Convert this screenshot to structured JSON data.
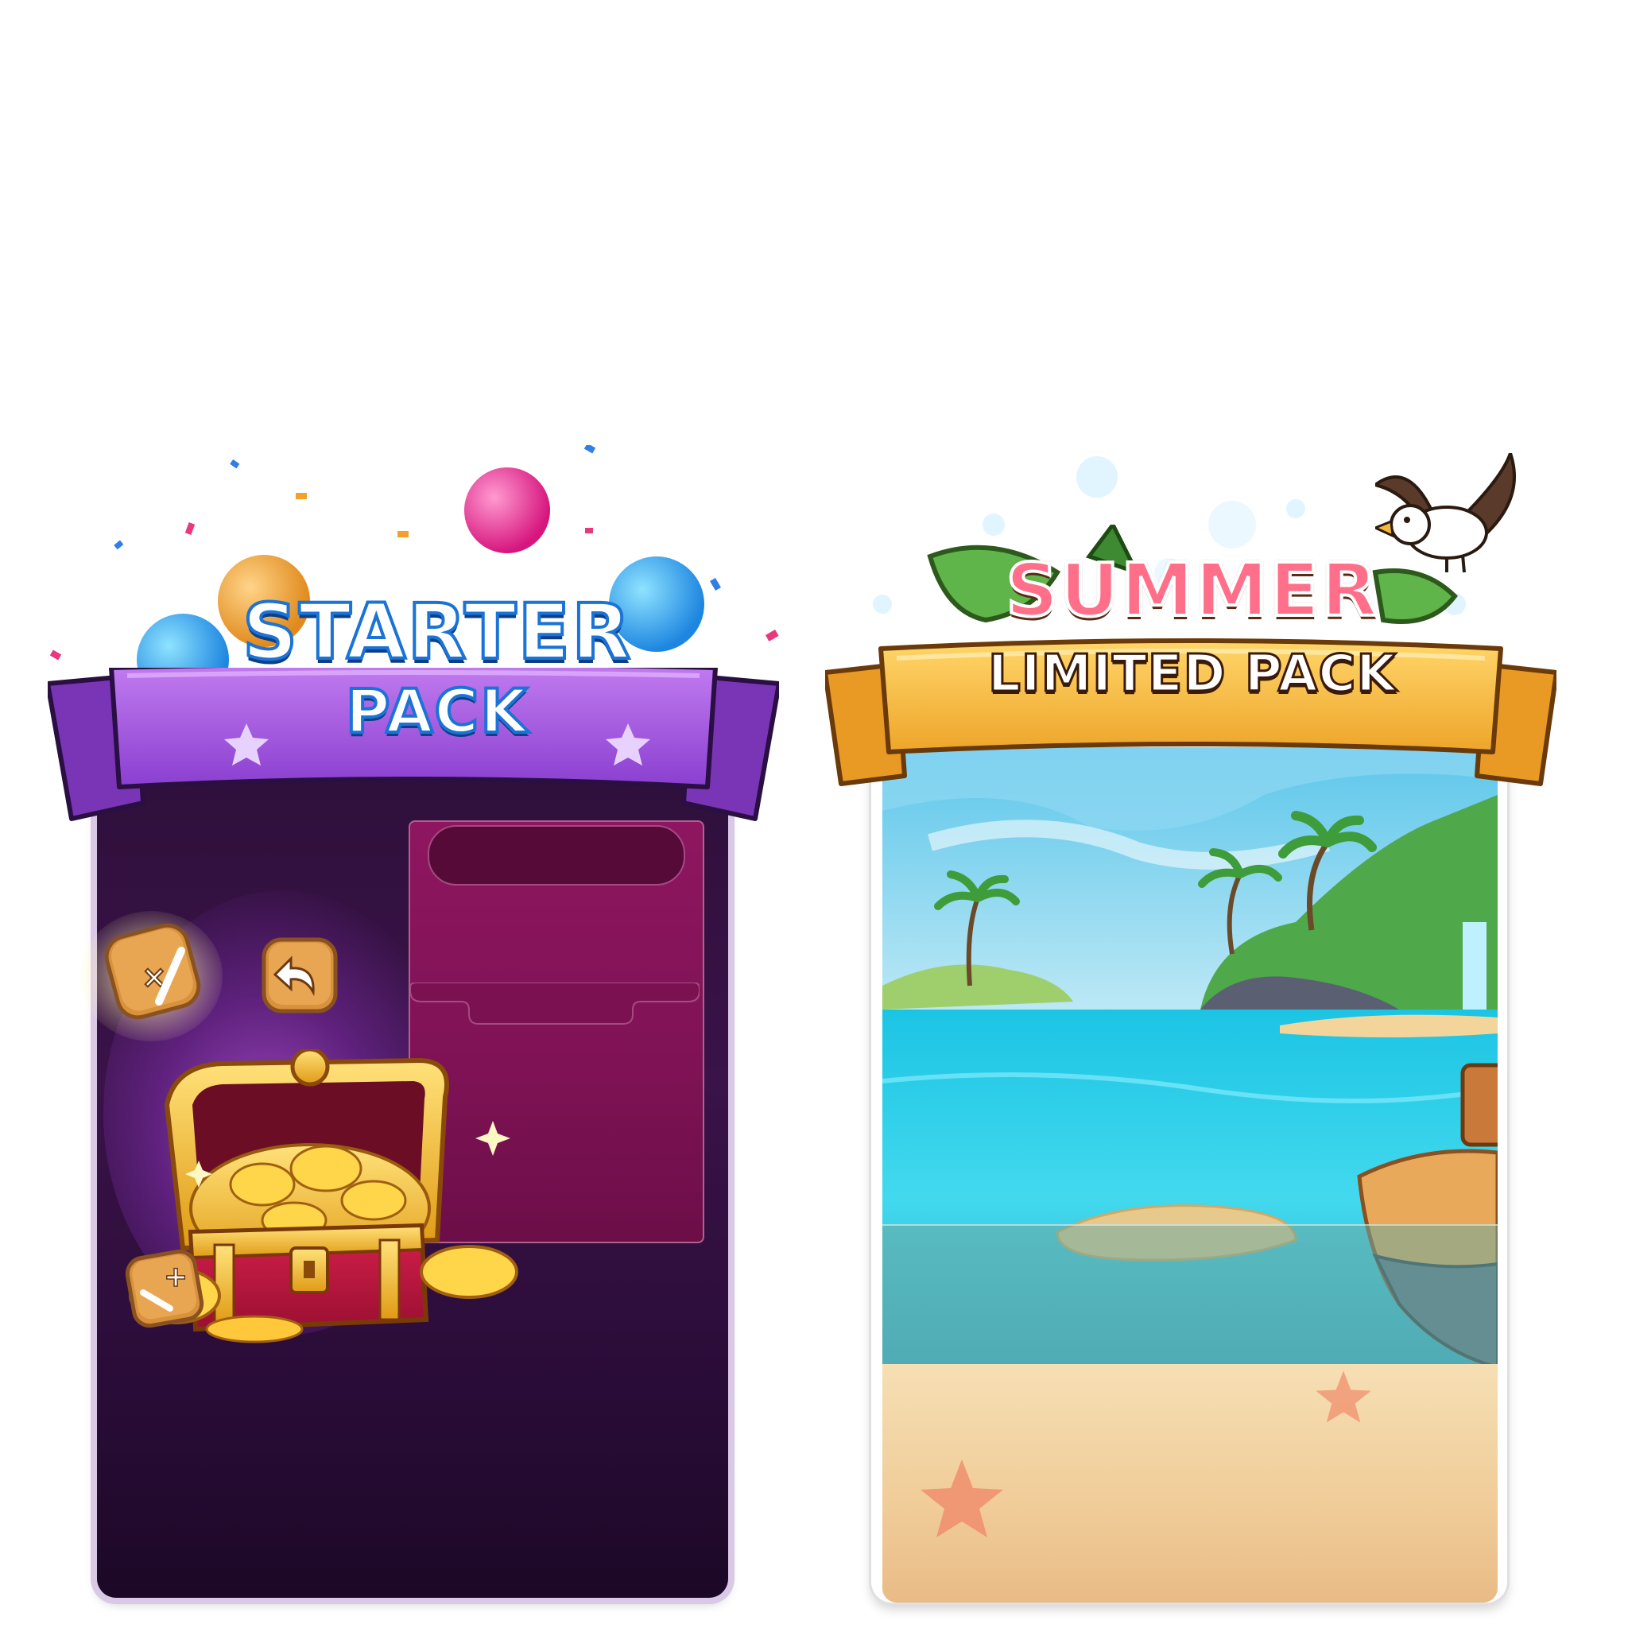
{
  "starter_pack": {
    "title_line1": "STARTER",
    "title_line2": "PACK",
    "icons": [
      "multiply-divide-tile-icon",
      "undo-tile-icon",
      "plus-minus-tile-icon",
      "treasure-chest-icon",
      "gold-fish-coins-icon"
    ],
    "colors": {
      "ribbon": "#9b4fd9",
      "panel": "#3a1248",
      "offer_slot": "#8c1458",
      "title_fill": "#ffffff",
      "title_outline": "#1e8fe0"
    }
  },
  "summer_pack": {
    "title_line1": "SUMMER",
    "title_line2": "LIMITED PACK",
    "icons": [
      "seagull-icon",
      "palm-leaf-icon",
      "tropical-island-scene",
      "wooden-boat-icon",
      "starfish-icon"
    ],
    "colors": {
      "ribbon": "#f2b43a",
      "title_fill": "#ff6f8a",
      "title_outline": "#5a2a12",
      "sea": "#2fc9e8",
      "sand": "#f3d8a8"
    }
  }
}
